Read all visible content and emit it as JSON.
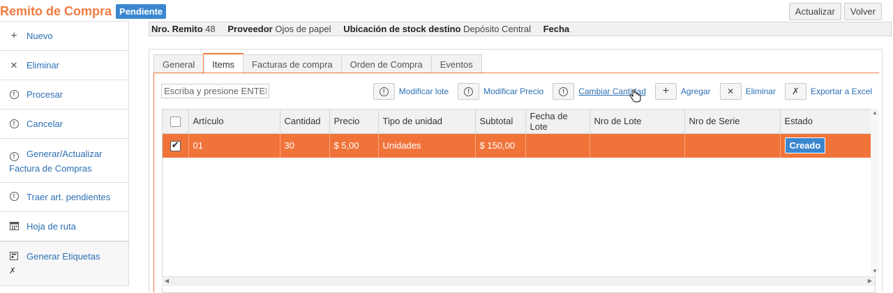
{
  "header": {
    "title": "Remito de Compra",
    "status": "Pendiente",
    "actions": [
      "Actualizar",
      "Volver"
    ]
  },
  "sidebar": {
    "items": [
      {
        "icon": "plus-icon",
        "label": "Nuevo"
      },
      {
        "icon": "x-icon",
        "label": "Eliminar"
      },
      {
        "icon": "exclamation-circle-icon",
        "label": "Procesar"
      },
      {
        "icon": "exclamation-circle-icon",
        "label": "Cancelar"
      },
      {
        "icon": "exclamation-circle-icon",
        "label": "Generar/Actualizar Factura de Compras"
      },
      {
        "icon": "exclamation-circle-icon",
        "label": "Traer art. pendientes"
      },
      {
        "icon": "calendar-icon",
        "label": "Hoja de ruta"
      },
      {
        "icon": "label-icon",
        "label": "Generar Etiquetas"
      }
    ]
  },
  "info": {
    "remito_label": "Nro. Remito",
    "remito_value": "48",
    "proveedor_label": "Proveedor",
    "proveedor_value": "Ojos de papel",
    "ubicacion_label": "Ubicación de stock destino",
    "ubicacion_value": "Depósito Central",
    "fecha_label": "Fecha",
    "fecha_value": ""
  },
  "tabs": [
    "General",
    "Items",
    "Facturas de compra",
    "Orden de Compra",
    "Eventos"
  ],
  "active_tab": "Items",
  "search": {
    "placeholder": "Escriba y presione ENTER"
  },
  "toolbar": {
    "modificar_lote": "Modificar lote",
    "modificar_precio": "Modificar Precio",
    "cambiar_cantidad": "Cambiar Cantidad",
    "agregar": "Agregar",
    "eliminar": "Eliminar",
    "exportar": "Exportar a Excel"
  },
  "grid": {
    "columns": [
      "Artículo",
      "Cantidad",
      "Precio",
      "Tipo de unidad",
      "Subtotal",
      "Fecha de Lote",
      "Nro de Lote",
      "Nro de Serie",
      "Estado"
    ],
    "rows": [
      {
        "checked": true,
        "articulo": "01",
        "cantidad": "30",
        "precio": "$ 5,00",
        "tipo_unidad": "Unidades",
        "subtotal": "$ 150,00",
        "fecha_lote": "",
        "nro_lote": "",
        "nro_serie": "",
        "estado": "Creado"
      }
    ]
  },
  "colors": {
    "accent": "#f07b3f",
    "badge": "#3a87d0",
    "selected_row": "#f0733a"
  }
}
